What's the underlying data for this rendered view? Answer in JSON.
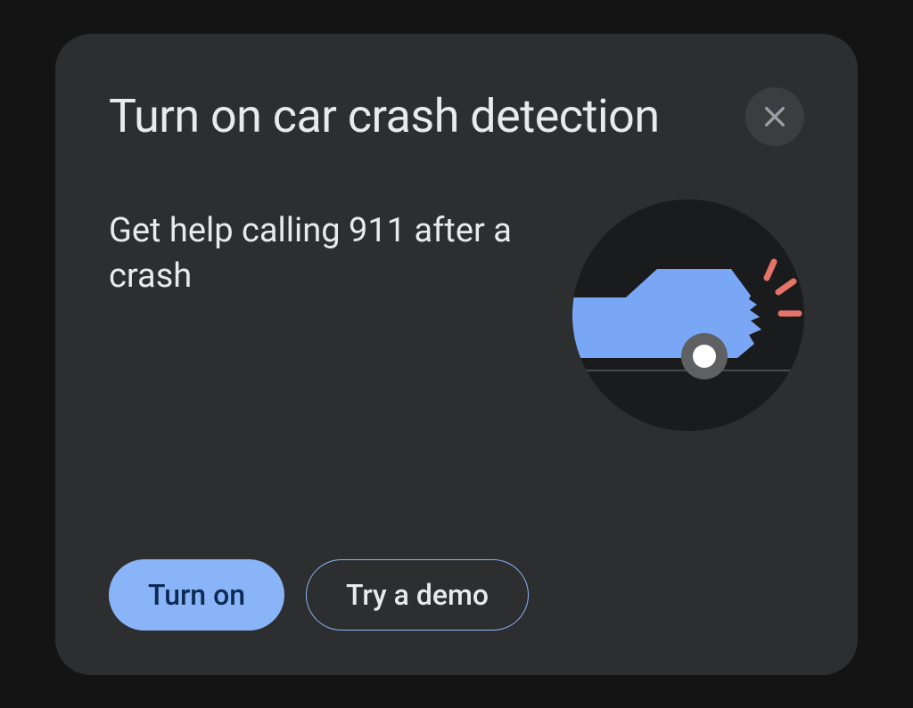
{
  "card": {
    "title": "Turn on car crash detection",
    "description": "Get help calling 911 after a crash",
    "illustration": "car-crash-icon",
    "actions": {
      "primary": "Turn on",
      "secondary": "Try a demo"
    },
    "close": "close-icon"
  },
  "colors": {
    "accent": "#8ab4f8",
    "card_bg": "#2d2e30",
    "page_bg": "#141414",
    "text": "#e8eaed"
  }
}
